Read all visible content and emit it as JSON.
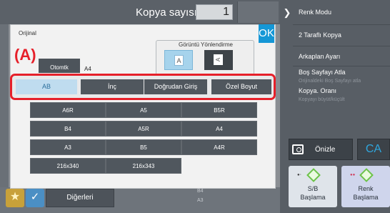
{
  "header": {
    "copy_label": "Kopya sayısı",
    "copy_count": "1"
  },
  "dialog": {
    "ok_label": "OK",
    "original_label": "Orijinal",
    "callout": "(A)",
    "auto_label": "Otomtk",
    "auto_value": "A4",
    "orientation_title": "Görüntü Yönlendirme",
    "orientation_upright_glyph": "A",
    "orientation_rotated_glyph": "A"
  },
  "tabs": [
    {
      "label": "AB",
      "active": true
    },
    {
      "label": "İnç",
      "active": false
    },
    {
      "label": "Doğrudan Giriş",
      "active": false
    },
    {
      "label": "Özel Boyut",
      "active": false
    }
  ],
  "sizes": [
    [
      "A6R",
      "A5",
      "B5R"
    ],
    [
      "B4",
      "A5R",
      "A4"
    ],
    [
      "A3",
      "B5",
      "A4R"
    ],
    [
      "216x340",
      "216x343"
    ]
  ],
  "right_panel": {
    "items": [
      "Renk Modu",
      "2 Taraflı Kopya",
      "Arkaplan Ayarı",
      "Boş Sayfayı Atla",
      "Kopya. Oranı"
    ],
    "subtexts": [
      "Orijinaldeki Boş Sayfayı atla",
      "Kopyayı büyüt/küçült"
    ],
    "preview_label": "Önizle",
    "ca_label": "CA",
    "bw_start": [
      "S/B",
      "Başlama"
    ],
    "color_start": [
      "Renk",
      "Başlama"
    ]
  },
  "bottom": {
    "others_label": "Diğerleri",
    "faint_b4": "B4",
    "faint_a3": "A3"
  },
  "colors": {
    "accent": "#1597d6",
    "highlight": "#e6202a",
    "active_tab": "#bfdcef"
  }
}
